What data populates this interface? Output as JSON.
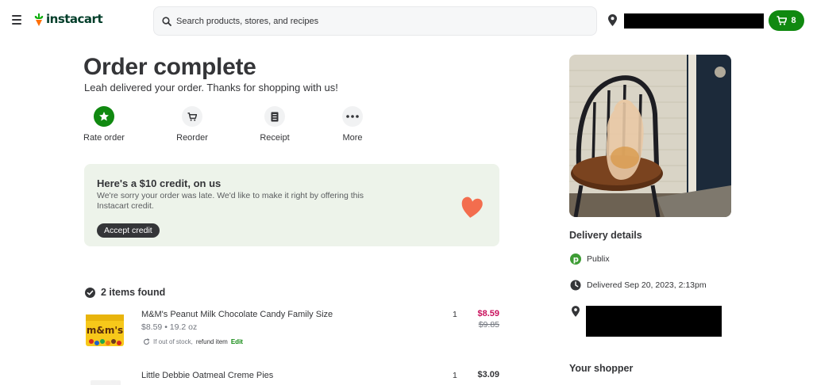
{
  "header": {
    "logo_text": "instacart",
    "search_placeholder": "Search products, stores, and recipes",
    "cart_count": "8",
    "colors": {
      "brand_green": "#108910",
      "logo_dark": "#003d29",
      "logo_carrot": "#ff7009"
    }
  },
  "order": {
    "title": "Order complete",
    "subtitle": "Leah delivered your order. Thanks for shopping with us!",
    "actions": [
      {
        "label": "Rate order",
        "icon": "star-icon"
      },
      {
        "label": "Reorder",
        "icon": "cart-icon"
      },
      {
        "label": "Receipt",
        "icon": "receipt-icon"
      },
      {
        "label": "More",
        "icon": "more-icon"
      }
    ]
  },
  "credit": {
    "title": "Here's a $10 credit, on us",
    "body": "We're sorry your order was late. We'd like to make it right by offering this Instacart credit.",
    "button": "Accept credit",
    "heart_color": "#f36d4e"
  },
  "items": {
    "found_label": "2 items found",
    "list": [
      {
        "name": "M&M's Peanut Milk Chocolate Candy Family Size",
        "meta": "$8.59 • 19.2 oz",
        "qty": "1",
        "price": "$8.59",
        "old_price": "$9.85",
        "price_color": "#c9105c",
        "oos_prefix": "If out of stock,",
        "oos_action": "refund item",
        "oos_edit": "Edit"
      },
      {
        "name": "Little Debbie Oatmeal Creme Pies",
        "qty": "1",
        "price": "$3.09",
        "price_color": "#343538"
      }
    ]
  },
  "sidebar": {
    "delivery_title": "Delivery details",
    "store": "Publix",
    "delivered": "Delivered Sep 20, 2023, 2:13pm",
    "shopper_title": "Your shopper"
  }
}
